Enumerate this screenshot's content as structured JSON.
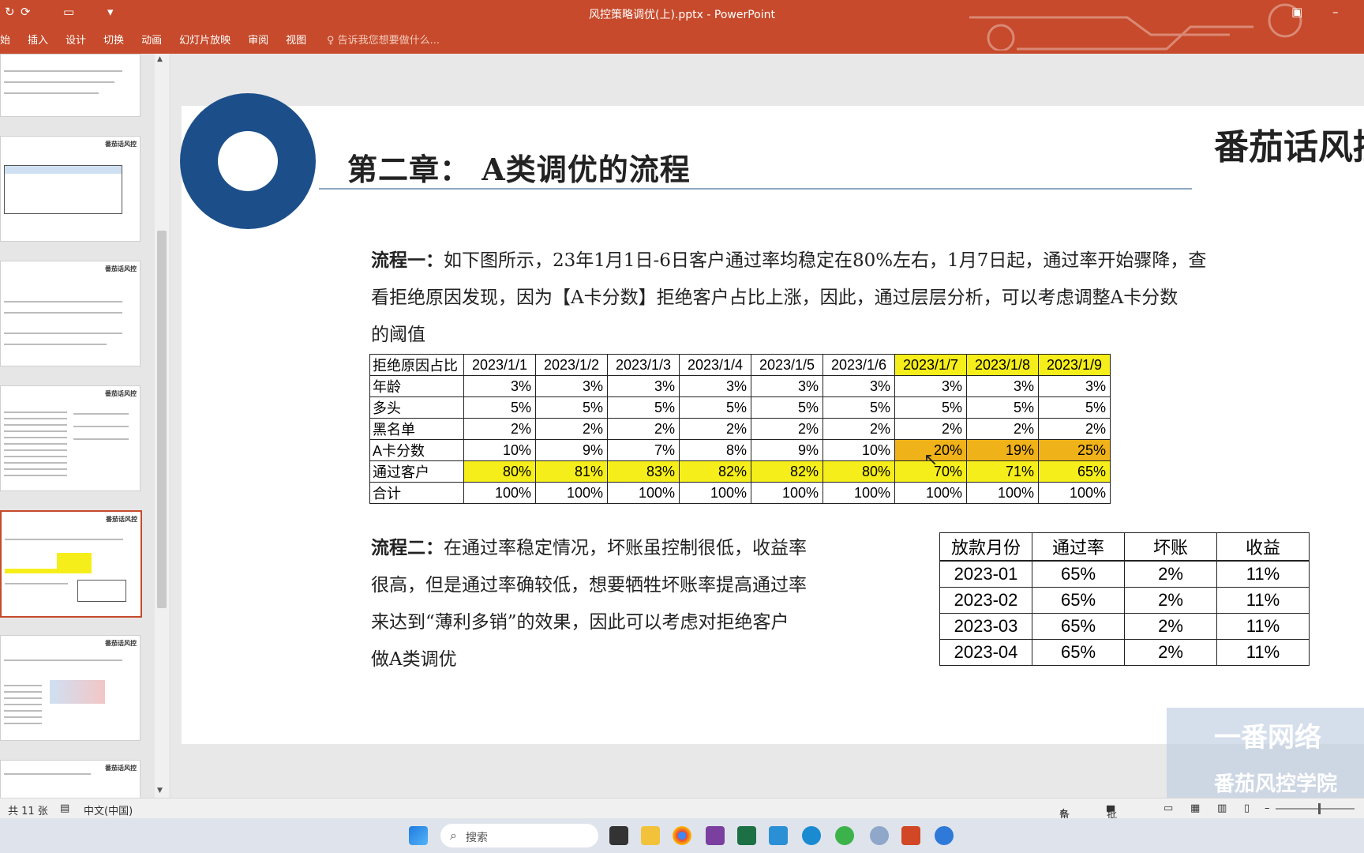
{
  "window": {
    "title": "风控策略调优(上).pptx - PowerPoint",
    "menu": [
      "始",
      "插入",
      "设计",
      "切换",
      "动画",
      "幻灯片放映",
      "审阅",
      "视图"
    ],
    "tell_me": "告诉我您想要做什么...",
    "quick_access": [
      "↻",
      "⟳",
      "▾"
    ],
    "controls": [
      "▣",
      "–"
    ]
  },
  "slide": {
    "title": "第二章：   A类调优的流程",
    "brand": "番茄话风控",
    "para1": {
      "label": "流程一：",
      "line1": "如下图所示，23年1月1日-6日客户通过率均稳定在80%左右，1月7日起，通过率开始骤降，查",
      "line2": "看拒绝原因发现，因为【A卡分数】拒绝客户占比上涨，因此，通过层层分析，可以考虑调整A卡分数",
      "line3": "的阈值"
    },
    "table1": {
      "header": [
        "拒绝原因占比",
        "2023/1/1",
        "2023/1/2",
        "2023/1/3",
        "2023/1/4",
        "2023/1/5",
        "2023/1/6",
        "2023/1/7",
        "2023/1/8",
        "2023/1/9"
      ],
      "rows": [
        [
          "年龄",
          "3%",
          "3%",
          "3%",
          "3%",
          "3%",
          "3%",
          "3%",
          "3%",
          "3%"
        ],
        [
          "多头",
          "5%",
          "5%",
          "5%",
          "5%",
          "5%",
          "5%",
          "5%",
          "5%",
          "5%"
        ],
        [
          "黑名单",
          "2%",
          "2%",
          "2%",
          "2%",
          "2%",
          "2%",
          "2%",
          "2%",
          "2%"
        ],
        [
          "A卡分数",
          "10%",
          "9%",
          "7%",
          "8%",
          "9%",
          "10%",
          "20%",
          "19%",
          "25%"
        ],
        [
          "通过客户",
          "80%",
          "81%",
          "83%",
          "82%",
          "82%",
          "80%",
          "70%",
          "71%",
          "65%"
        ],
        [
          "合计",
          "100%",
          "100%",
          "100%",
          "100%",
          "100%",
          "100%",
          "100%",
          "100%",
          "100%"
        ]
      ],
      "highlight_yellow": "#f6ee1a",
      "highlight_orange": "#f0b219"
    },
    "para2": {
      "label": "流程二：",
      "line1": "在通过率稳定情况，坏账虽控制很低，收益率",
      "line2": "很高，但是通过率确较低，想要牺牲坏账率提高通过率",
      "line3": "来达到“薄利多销”的效果，因此可以考虑对拒绝客户",
      "line4": "做A类调优"
    },
    "table2": {
      "header": [
        "放款月份",
        "通过率",
        "坏账",
        "收益"
      ],
      "rows": [
        [
          "2023-01",
          "65%",
          "2%",
          "11%"
        ],
        [
          "2023-02",
          "65%",
          "2%",
          "11%"
        ],
        [
          "2023-03",
          "65%",
          "2%",
          "11%"
        ],
        [
          "2023-04",
          "65%",
          "2%",
          "11%"
        ]
      ]
    },
    "watermark": {
      "line1": "一番网络",
      "line2": "番茄风控学院"
    }
  },
  "thumbnails": {
    "brand": "番茄话风控",
    "count": 6,
    "selected_index": 4
  },
  "status": {
    "slides": "共 11 张",
    "language": "中文(中国)",
    "notes": "备注",
    "comments": "批注"
  },
  "taskbar": {
    "search": "搜索"
  },
  "colors": {
    "ribbon": "#c64a2b",
    "ring": "#1c4f8a"
  }
}
